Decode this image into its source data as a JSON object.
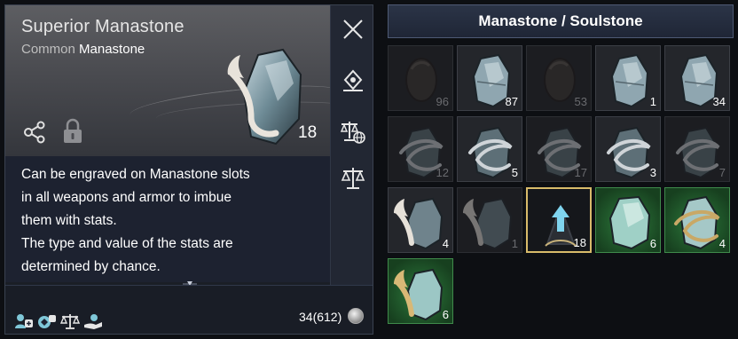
{
  "detail": {
    "item_name": "Superior Manastone",
    "grade_word": "Common",
    "type_word": "Manastone",
    "count": "18",
    "description_lines": [
      "Can be engraved on Manastone slots",
      "in all weapons and armor to imbue",
      "them with stats.",
      "The type and value of the stats are",
      "determined by chance."
    ],
    "owned": "34(612)",
    "icons": {
      "close": "close-icon",
      "locate": "locate-icon",
      "compare_market": "scale-globe-icon",
      "compare": "scale-icon",
      "share": "share-icon",
      "lock": "lock-icon"
    }
  },
  "grid": {
    "title": "Manastone / Soulstone",
    "slots": [
      {
        "style": "dim",
        "art": "egg",
        "count": "96"
      },
      {
        "style": "normal",
        "art": "stone",
        "count": "87"
      },
      {
        "style": "dim",
        "art": "egg",
        "count": "53"
      },
      {
        "style": "normal",
        "art": "stone",
        "count": "1"
      },
      {
        "style": "normal",
        "art": "stone",
        "count": "34"
      },
      {
        "style": "dim",
        "art": "wrapped",
        "count": "12"
      },
      {
        "style": "normal",
        "art": "wrapped",
        "count": "5"
      },
      {
        "style": "dim",
        "art": "wrapped",
        "count": "17"
      },
      {
        "style": "normal",
        "art": "wrapped",
        "count": "3"
      },
      {
        "style": "dim",
        "art": "wrapped",
        "count": "7"
      },
      {
        "style": "normal",
        "art": "winged",
        "count": "4"
      },
      {
        "style": "dim",
        "art": "winged",
        "count": "1"
      },
      {
        "style": "selected",
        "art": "arrow",
        "count": "18"
      },
      {
        "style": "green",
        "art": "green",
        "count": "6"
      },
      {
        "style": "green",
        "art": "gold-wrapped",
        "count": "4"
      },
      {
        "style": "green",
        "art": "gold-winged",
        "count": "6"
      }
    ]
  },
  "colors": {
    "selected_border": "#d8bb6a",
    "green_slot": "#2d7a3c",
    "header_bg": "#2b3447"
  }
}
